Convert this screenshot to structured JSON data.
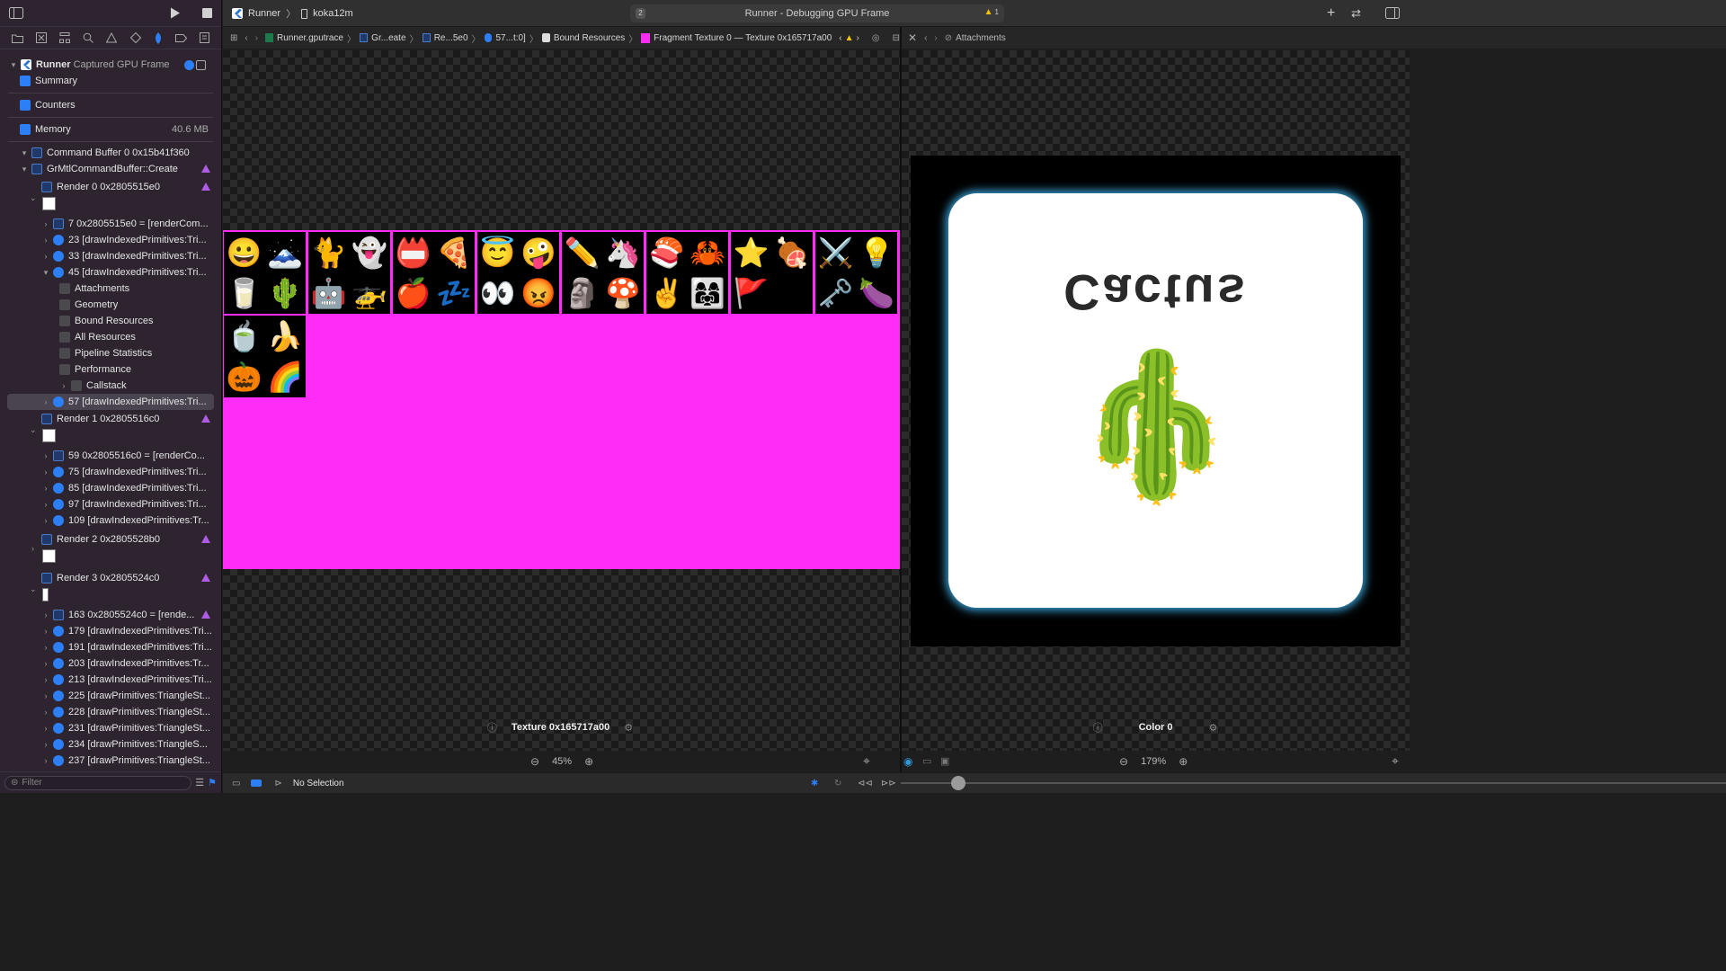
{
  "window": {
    "title": "Runner - Debugging GPU Frame",
    "issue_count": "1"
  },
  "toolbar": {
    "scheme": "Runner",
    "device": "koka12m",
    "activity_badge": "2"
  },
  "sidebar": {
    "root": {
      "app": "Runner",
      "subtitle": "Captured GPU Frame"
    },
    "summary": "Summary",
    "counters": "Counters",
    "memory": {
      "label": "Memory",
      "value": "40.6 MB"
    },
    "command_buffer": "Command Buffer 0 0x15b41f360",
    "create": "GrMtlCommandBuffer::Create",
    "render0": "Render 0 0x2805515e0",
    "r0_items": [
      "7 0x2805515e0 = [renderCom...",
      "23 [drawIndexedPrimitives:Tri...",
      "33 [drawIndexedPrimitives:Tri...",
      "45 [drawIndexedPrimitives:Tri..."
    ],
    "sub_items": [
      "Attachments",
      "Geometry",
      "Bound Resources",
      "All Resources",
      "Pipeline Statistics",
      "Performance",
      "Callstack"
    ],
    "selected": "57 [drawIndexedPrimitives:Tri...",
    "render1": "Render 1 0x2805516c0",
    "r1_items": [
      "59 0x2805516c0 = [renderCo...",
      "75 [drawIndexedPrimitives:Tri...",
      "85 [drawIndexedPrimitives:Tri...",
      "97 [drawIndexedPrimitives:Tri...",
      "109 [drawIndexedPrimitives:Tr..."
    ],
    "render2": "Render 2 0x2805528b0",
    "render3": "Render 3 0x2805524c0",
    "r3_items": [
      "163 0x2805524c0 = [rende...",
      "179 [drawIndexedPrimitives:Tri...",
      "191 [drawIndexedPrimitives:Tri...",
      "203 [drawIndexedPrimitives:Tr...",
      "213 [drawIndexedPrimitives:Tri...",
      "225 [drawPrimitives:TriangleSt...",
      "228 [drawPrimitives:TriangleSt...",
      "231 [drawPrimitives:TriangleSt...",
      "234 [drawPrimitives:TriangleS...",
      "237 [drawPrimitives:TriangleSt..."
    ],
    "filter_placeholder": "Filter"
  },
  "pathbar": {
    "crumbs": [
      "Runner.gputrace",
      "Gr...eate",
      "Re...5e0",
      "57...t:0]",
      "Bound Resources",
      "Fragment Texture 0 — Texture 0x165717a00"
    ]
  },
  "pathbar2": {
    "title": "Attachments"
  },
  "texture_atlas": {
    "row1": [
      [
        "😀",
        "🗻",
        "🐈",
        "👻"
      ],
      [
        "📛",
        "🍕",
        "🍎",
        "💤"
      ],
      [
        "😇",
        "🤪",
        "👀",
        "😡"
      ],
      [
        "✏️",
        "🦄",
        "🗿",
        "🍄"
      ],
      [
        "🍣",
        "🦀",
        "✌️",
        "👩‍👩‍👧"
      ],
      [
        "⭐",
        "🍖",
        "🚩",
        ""
      ],
      [
        "⚔️",
        "💡",
        "🗝️",
        "🍆"
      ]
    ],
    "row1_fix": [
      [
        "😀",
        "🗻",
        "🥛",
        "🌵"
      ],
      [
        "🐈",
        "👻",
        "🤖",
        "🚁"
      ],
      [
        "📛",
        "🍕",
        "🍎",
        "💤"
      ],
      [
        "😇",
        "🤪",
        "👀",
        "😡"
      ],
      [
        "✏️",
        "🦄",
        "🗿",
        "🍄"
      ],
      [
        "🍣",
        "🦀",
        "✌️",
        "👩‍👩‍👧"
      ],
      [
        "⭐",
        "🍖",
        "🚩",
        ""
      ],
      [
        "⚔️",
        "💡",
        "🗝️",
        "🍆"
      ]
    ],
    "row2": [
      [
        "🍵",
        "🍌",
        "🎃",
        "🌈"
      ]
    ]
  },
  "left_panel": {
    "label": "Texture 0x165717a00",
    "zoom": "45%"
  },
  "right_panel": {
    "label": "Color 0",
    "zoom": "179%",
    "card_text": "Cactus",
    "card_emoji": "🌵"
  },
  "debugbar": {
    "selection": "No Selection"
  }
}
